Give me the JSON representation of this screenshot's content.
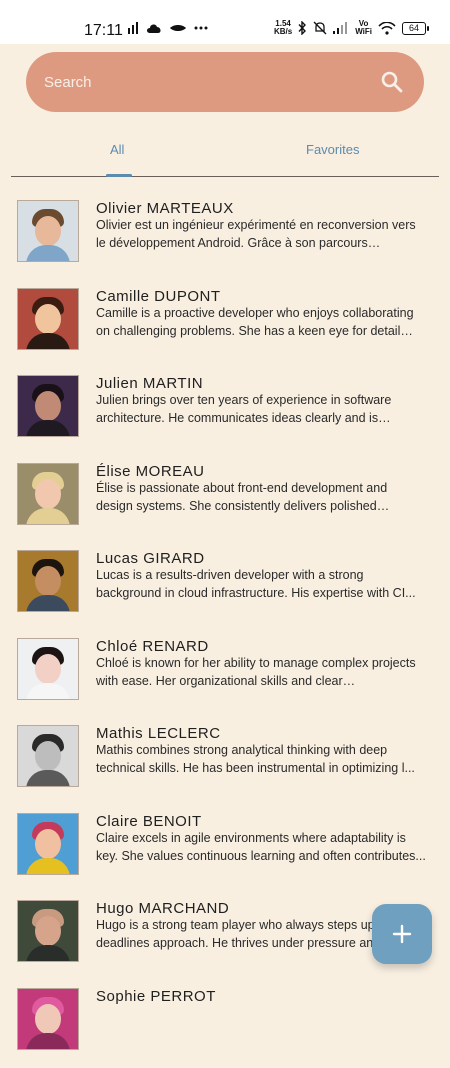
{
  "status_bar": {
    "time": "17:11",
    "speed_value": "1.54",
    "speed_unit": "KB/s",
    "vowifi_top": "Vo",
    "vowifi_bottom": "WiFi",
    "battery": "64"
  },
  "search": {
    "placeholder": "Search"
  },
  "tabs": {
    "all": "All",
    "favorites": "Favorites"
  },
  "people": [
    {
      "name": "Olivier MARTEAUX",
      "description": "Olivier est un ingénieur expérimenté en reconversion vers le développement Android. Grâce à son parcours structuré..."
    },
    {
      "name": "Camille DUPONT",
      "description": "Camille is a proactive developer who enjoys collaborating on challenging problems. She has a keen eye for detail and..."
    },
    {
      "name": "Julien MARTIN",
      "description": "Julien brings over ten years of experience in software architecture. He communicates ideas clearly and is always..."
    },
    {
      "name": "Élise MOREAU",
      "description": "Élise is passionate about front-end development and design systems. She consistently delivers polished interfaces..."
    },
    {
      "name": "Lucas GIRARD",
      "description": "Lucas is a results-driven developer with a strong background in cloud infrastructure. His expertise with CI..."
    },
    {
      "name": "Chloé RENARD",
      "description": "Chloé is known for her ability to manage complex projects with ease. Her organizational skills and clear communication..."
    },
    {
      "name": "Mathis LECLERC",
      "description": "Mathis combines strong analytical thinking with deep technical skills. He has been instrumental in optimizing l..."
    },
    {
      "name": "Claire BENOIT",
      "description": "Claire excels in agile environments where adaptability is key. She values continuous learning and often contributes..."
    },
    {
      "name": "Hugo MARCHAND",
      "description": "Hugo is a strong team player who always steps up when deadlines approach. He thrives under pressure and..."
    },
    {
      "name": "Sophie PERROT",
      "description": ""
    }
  ],
  "colors": {
    "background": "#f8efe1",
    "search_bar": "#de9a81",
    "accent": "#5b8bb0",
    "fab": "#6fa0bf"
  },
  "icons": {
    "search": "search-icon",
    "fab": "add-icon"
  }
}
